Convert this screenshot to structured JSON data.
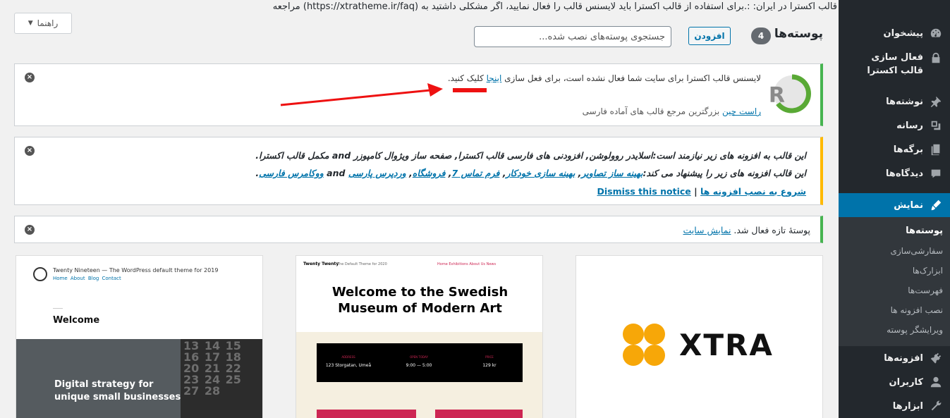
{
  "top_notice": "قالب اکسترا در ایران: :.برای استفاده از قالب اکسترا باید لایسنس قالب را فعال نمایید، اگر مشکلی داشتید به (https://xtratheme.ir/faq) مراجعه نمایید.",
  "help_button": "راهنما",
  "header": {
    "title": "پوسته‌ها",
    "count": "4",
    "add_label": "افزودن",
    "search_placeholder": "جستجوی پوسته‌های نصب شده..."
  },
  "notices": {
    "license": {
      "text_before": "لایسنس قالب اکسترا برای سایت شما فعال نشده است، برای فعل سازی ",
      "link": "اینجا",
      "text_after": " کلیک کنید.",
      "footer_link": "راست چین",
      "footer_text": " بزرگترین مرجع قالب های آماده فارسی"
    },
    "plugins": {
      "line1": "این قالب به افزونه های زیر نیازمند است:اسلایدر روولوشن, افزودنی های فارسی قالب اکسترا, صفحه ساز ویژوال کامپوزر and مکمل قالب اکسترا.",
      "line2_prefix": "این قالب افزونه های زیر را پیشنهاد می کند:",
      "recommended": [
        "بهینه ساز تصاویر",
        "بهینه سازی خودکار",
        "فرم تماس 7",
        "فروشگاه",
        "وردپرس پارسی"
      ],
      "line2_and": " and ",
      "recommended_last": "ووکامرس فارسی",
      "install_link": "شروع به نصب افزونه ها",
      "separator": "|",
      "dismiss_link": "Dismiss this notice"
    },
    "activated": {
      "text": "پوستهٔ تازه فعال شد. ",
      "link": "نمایش سایت"
    }
  },
  "sidebar": {
    "items": [
      {
        "label": "پیشخوان",
        "icon": "dashboard-icon"
      },
      {
        "label": "فعال سازی قالب اکسترا",
        "icon": "lock-icon"
      },
      {
        "label": "نوشته‌ها",
        "icon": "pin-icon"
      },
      {
        "label": "رسانه",
        "icon": "media-icon"
      },
      {
        "label": "برگه‌ها",
        "icon": "pages-icon"
      },
      {
        "label": "دیدگاه‌ها",
        "icon": "comments-icon"
      },
      {
        "label": "نمایش",
        "icon": "brush-icon"
      },
      {
        "label": "افزونه‌ها",
        "icon": "plugin-icon"
      },
      {
        "label": "کاربران",
        "icon": "users-icon"
      },
      {
        "label": "ابزارها",
        "icon": "tools-icon"
      }
    ],
    "submenu": [
      "پوسته‌ها",
      "سفارشی‌سازی",
      "ابزارک‌ها",
      "فهرست‌ها",
      "نصب افزونه ها",
      "ویرایشگر پوسته"
    ]
  },
  "themes": {
    "t19": {
      "site_title": "Twenty Nineteen — The WordPress default theme for 2019",
      "nav": "Home About Blog Contact",
      "welcome": "Welcome",
      "calendar": "13 14 15 16 17 18 20 21 22 23 24 25 27 28",
      "tagline_1": "Digital strategy for",
      "tagline_2": "unique small businesses"
    },
    "t20": {
      "brand": "Twenty Twenty",
      "tag": "The Default Theme for 2020",
      "menu": "Home  Exhibitions  About Us  News",
      "title_1": "Welcome to the Swedish",
      "title_2": "Museum of Modern Art",
      "cols": [
        {
          "k": "ADDRESS",
          "v": "123 Storgatan, Umeå"
        },
        {
          "k": "OPEN TODAY",
          "v": "9:00 — 5:00"
        },
        {
          "k": "PRICE",
          "v": "129 kr"
        }
      ]
    },
    "xtra": {
      "word": "XTRA"
    }
  },
  "colors": {
    "sidebar_bg": "#23282d",
    "active_bg": "#0073aa",
    "green": "#46b450",
    "yellow": "#ffb900",
    "xtra_orange": "#f7a708"
  }
}
